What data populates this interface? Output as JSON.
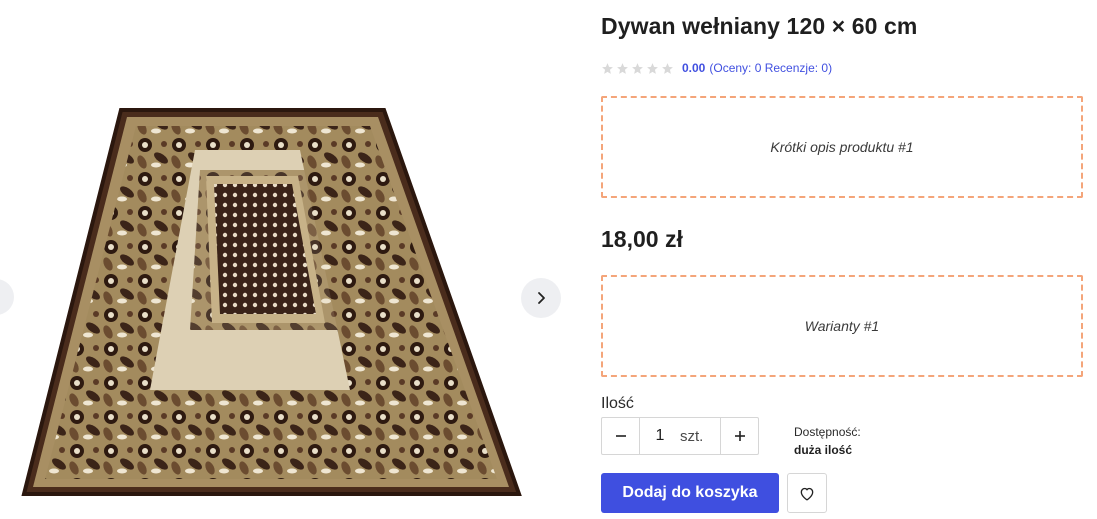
{
  "product": {
    "title": "Dywan wełniany 120 × 60 cm",
    "rating": {
      "stars": 0,
      "max_stars": 5,
      "value": "0.00",
      "meta": "(Oceny: 0 Recenzje: 0)"
    },
    "short_description_placeholder": "Krótki opis produktu #1",
    "price": "18,00 zł",
    "variants_placeholder": "Warianty #1"
  },
  "quantity": {
    "label": "Ilość",
    "value": "1",
    "unit": "szt."
  },
  "availability": {
    "label": "Dostępność:",
    "value": "duża ilość"
  },
  "actions": {
    "add_to_cart_label": "Dodaj do koszyka"
  },
  "icons": {
    "prev": "chevron-left-icon",
    "next": "chevron-right-icon",
    "star": "star-icon",
    "minus": "minus-icon",
    "plus": "plus-icon",
    "wishlist": "heart-icon"
  },
  "colors": {
    "accent": "#3f4fe0",
    "rating_link": "#4150e0",
    "placeholder_border": "#f4a57a",
    "star_empty": "#d9d9d9"
  }
}
